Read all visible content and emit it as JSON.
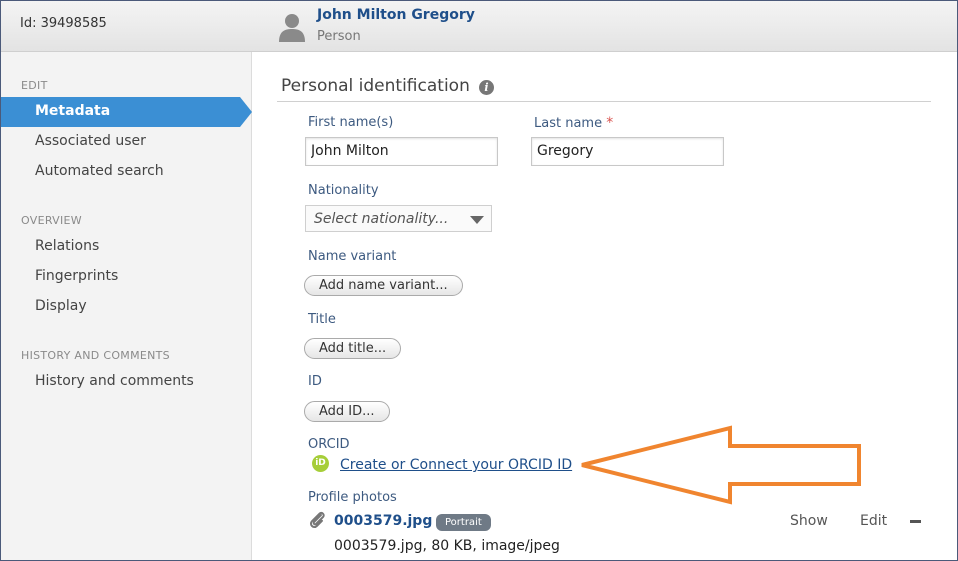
{
  "header": {
    "id_label": "Id: 39498585",
    "person_name": "John Milton Gregory",
    "person_type": "Person"
  },
  "sidebar": {
    "sections": [
      {
        "label": "EDIT",
        "items": [
          "Metadata",
          "Associated user",
          "Automated search"
        ]
      },
      {
        "label": "OVERVIEW",
        "items": [
          "Relations",
          "Fingerprints",
          "Display"
        ]
      },
      {
        "label": "HISTORY AND COMMENTS",
        "items": [
          "History and comments"
        ]
      }
    ],
    "active_item": "Metadata"
  },
  "main": {
    "section_title": "Personal identification",
    "first_name": {
      "label": "First name(s)",
      "value": "John Milton"
    },
    "last_name": {
      "label": "Last name",
      "value": "Gregory",
      "required_marker": "*"
    },
    "nationality": {
      "label": "Nationality",
      "placeholder": "Select nationality..."
    },
    "name_variant": {
      "label": "Name variant",
      "button": "Add name variant..."
    },
    "title": {
      "label": "Title",
      "button": "Add title..."
    },
    "id": {
      "label": "ID",
      "button": "Add ID..."
    },
    "orcid": {
      "label": "ORCID",
      "icon_text": "iD",
      "link": "Create or Connect your ORCID ID"
    },
    "profile_photos": {
      "label": "Profile photos",
      "file_name": "0003579.jpg",
      "badge": "Portrait",
      "file_meta": "0003579.jpg, 80 KB, image/jpeg",
      "show": "Show",
      "edit": "Edit"
    }
  },
  "colors": {
    "accent": "#3b8fd4",
    "link": "#1f4f8a",
    "orcid_green": "#a6ce39",
    "annotation_arrow": "#f0852f",
    "required": "#d9534f"
  }
}
